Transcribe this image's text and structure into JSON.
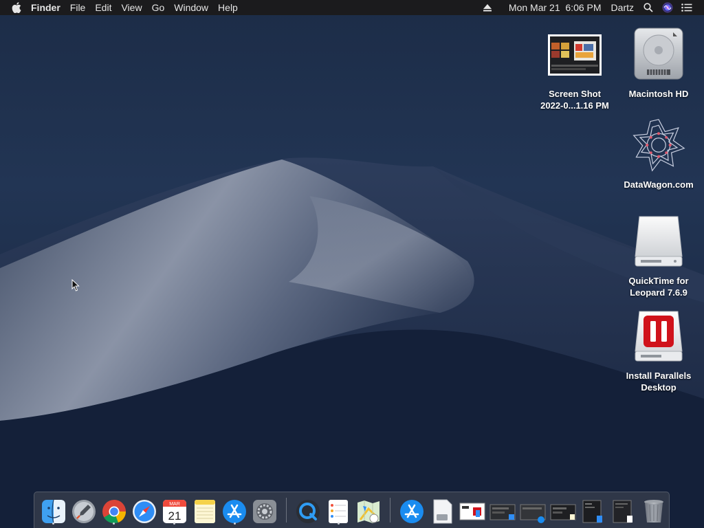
{
  "menubar": {
    "app_name": "Finder",
    "menus": [
      "File",
      "Edit",
      "View",
      "Go",
      "Window",
      "Help"
    ],
    "clock": "Mon Mar 21  6:06 PM",
    "user": "Dartz"
  },
  "desktop": {
    "icons": [
      {
        "label": "Screen Shot\n2022-0...1.16 PM",
        "kind": "screenshot-file"
      },
      {
        "label": "Macintosh HD",
        "kind": "hard-drive"
      },
      {
        "label": "DataWagon.com",
        "kind": "webloc"
      },
      {
        "label": "QuickTime for\nLeopard 7.6.9",
        "kind": "disk-image"
      },
      {
        "label": "Install Parallels\nDesktop",
        "kind": "parallels-installer"
      }
    ]
  },
  "dock": {
    "calendar_month": "MAR",
    "calendar_day": "21",
    "apps": [
      "Finder",
      "Launchpad",
      "Google Chrome",
      "Safari",
      "Calendar",
      "Notes",
      "App Store",
      "System Preferences",
      "QuickTime Player",
      "Reminders",
      "Maps"
    ],
    "running": [
      "Finder",
      "Google Chrome",
      "Calendar",
      "App Store",
      "Reminders"
    ]
  },
  "colors": {
    "menubar_bg": "#1b1b1d",
    "parallels_red": "#d0121b"
  }
}
